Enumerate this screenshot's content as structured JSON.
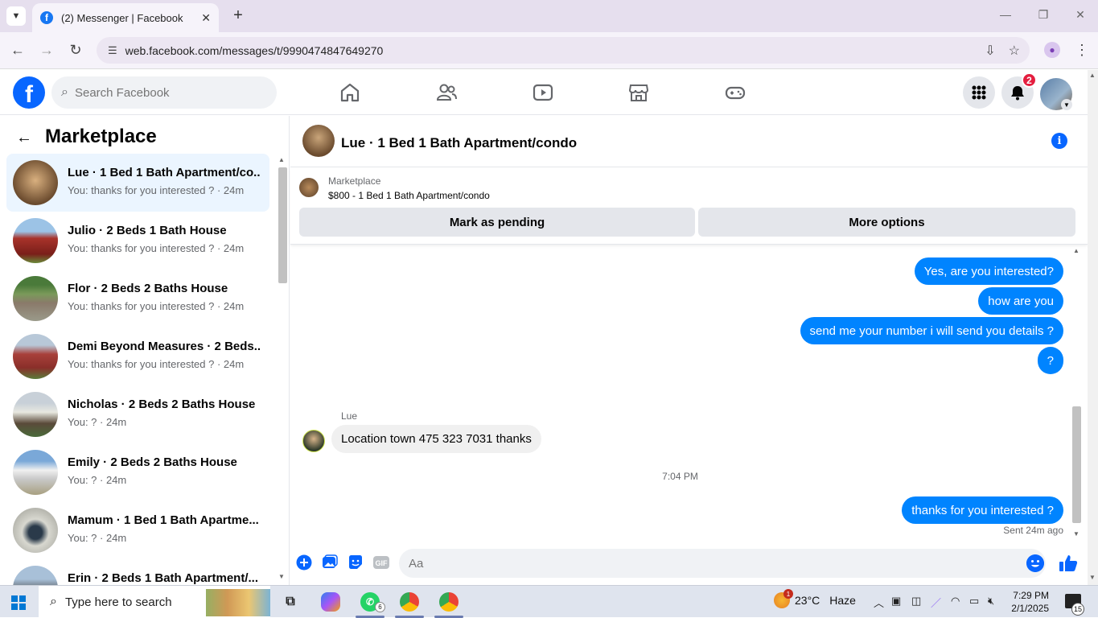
{
  "browser": {
    "tab_title": "(2) Messenger | Facebook",
    "url": "web.facebook.com/messages/t/9990474847649270"
  },
  "header": {
    "search_placeholder": "Search Facebook",
    "notification_count": "2"
  },
  "sidebar": {
    "title": "Marketplace",
    "conversations": [
      {
        "name": "Lue · 1 Bed 1 Bath Apartment/co...",
        "snippet": "You: thanks for you interested ? · 24m",
        "active": true
      },
      {
        "name": "Julio · 2 Beds 1 Bath House",
        "snippet": "You: thanks for you interested ? · 24m"
      },
      {
        "name": "Flor · 2 Beds 2 Baths House",
        "snippet": "You: thanks for you interested ? · 24m"
      },
      {
        "name": "Demi Beyond Measures · 2 Beds...",
        "snippet": "You: thanks for you interested ? · 24m"
      },
      {
        "name": "Nicholas · 2 Beds 2 Baths House",
        "snippet": "You: ? · 24m"
      },
      {
        "name": "Emily · 2 Beds 2 Baths House",
        "snippet": "You: ? · 24m"
      },
      {
        "name": "Mamum · 1 Bed 1 Bath Apartme...",
        "snippet": "You: ? · 24m"
      },
      {
        "name": "Erin · 2 Beds 1 Bath Apartment/...",
        "snippet": ""
      }
    ]
  },
  "chat": {
    "title": "Lue · 1 Bed 1 Bath Apartment/condo",
    "listing_label": "Marketplace",
    "listing_price": "$800 - 1 Bed 1 Bath Apartment/condo",
    "mark_pending_label": "Mark as pending",
    "more_options_label": "More options",
    "outgoing_1": "Yes, are you interested?",
    "outgoing_2": "how are you",
    "outgoing_3": "send me your number i will send you details ?",
    "outgoing_4": "?",
    "sender_name": "Lue",
    "incoming_1": "Location town 475 323 7031 thanks",
    "time_separator": "7:04 PM",
    "outgoing_5": "thanks for you interested ?",
    "sent_status": "Sent 24m ago",
    "composer_placeholder": "Aa"
  },
  "taskbar": {
    "search_text": "Type here to search",
    "whatsapp_count": "6",
    "weather_temp": "23°C",
    "weather_desc": "Haze",
    "weather_badge": "1",
    "time": "7:29 PM",
    "date": "2/1/2025",
    "notification_count": "15"
  },
  "colors": {
    "facebook_blue": "#0866ff",
    "messenger_bubble": "#0084ff",
    "badge_red": "#e41e3f"
  }
}
